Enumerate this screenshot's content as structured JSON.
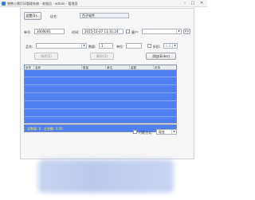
{
  "window": {
    "title": "销售小票打印管理系统 - 收银员 - admin - 管理员",
    "minimize_glyph": "–",
    "maximize_glyph": "□",
    "close_glyph": "✕"
  },
  "toolbar": {
    "settings_button": "设置(S)...",
    "store_label": "店名:",
    "store_value": "百子软件"
  },
  "order": {
    "number_label": "单号:",
    "number_value": "3000001",
    "time_label": "时间:",
    "time_value": "2015-12-07 11:31:24",
    "customer_label": "客户:",
    "customer_value": "",
    "more_button": ">>"
  },
  "item": {
    "name_label": "品名:",
    "name_value": "",
    "qty_label": "数量:",
    "qty_value": "1",
    "unit_label": "单位:",
    "unit_value": "",
    "discount_label": "折扣:",
    "discount_value": "0.8",
    "modify_button": "修改(E)",
    "delete_button": "删除(D)",
    "add_button": "添加(Enter)"
  },
  "grid": {
    "columns": [
      "序号",
      "名称",
      "数量",
      "单位",
      "金额",
      "折扣"
    ]
  },
  "summary": {
    "qty_text": "总数量: 0",
    "amount_text": "总金额: 0.00"
  },
  "payment": {
    "label": "付款方式:",
    "value": "现金"
  }
}
